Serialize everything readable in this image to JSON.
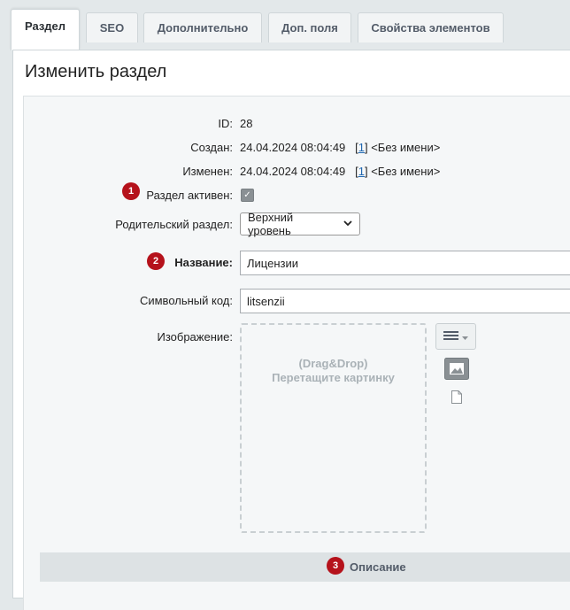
{
  "tabs": [
    {
      "label": "Раздел",
      "active": true
    },
    {
      "label": "SEO",
      "active": false
    },
    {
      "label": "Дополнительно",
      "active": false
    },
    {
      "label": "Доп. поля",
      "active": false
    },
    {
      "label": "Свойства элементов",
      "active": false
    }
  ],
  "page_title": "Изменить раздел",
  "fields": {
    "id": {
      "label": "ID:",
      "value": "28"
    },
    "created": {
      "label": "Создан:",
      "date": "24.04.2024 08:04:49",
      "user_id": "1",
      "user_name": "<Без имени>"
    },
    "modified": {
      "label": "Изменен:",
      "date": "24.04.2024 08:04:49",
      "user_id": "1",
      "user_name": "<Без имени>"
    },
    "active": {
      "label": "Раздел активен:",
      "checked": true,
      "badge": "1"
    },
    "parent": {
      "label": "Родительский раздел:",
      "selected": "Верхний уровень"
    },
    "name": {
      "label": "Название:",
      "value": "Лицензии",
      "badge": "2"
    },
    "code": {
      "label": "Символьный код:",
      "value": "litsenzii"
    },
    "image": {
      "label": "Изображение:",
      "dropzone_line1": "(Drag&Drop)",
      "dropzone_line2": "Перетащите картинку"
    }
  },
  "description_section": {
    "label": "Описание",
    "badge": "3"
  },
  "icons": [
    "hamburger-menu-icon",
    "caret-down-icon",
    "image-icon",
    "file-icon",
    "checkmark-icon",
    "chevron-down-icon"
  ],
  "colors": {
    "badge": "#b5121b",
    "link": "#2067b0",
    "accent_bg": "#e3e8ea"
  }
}
